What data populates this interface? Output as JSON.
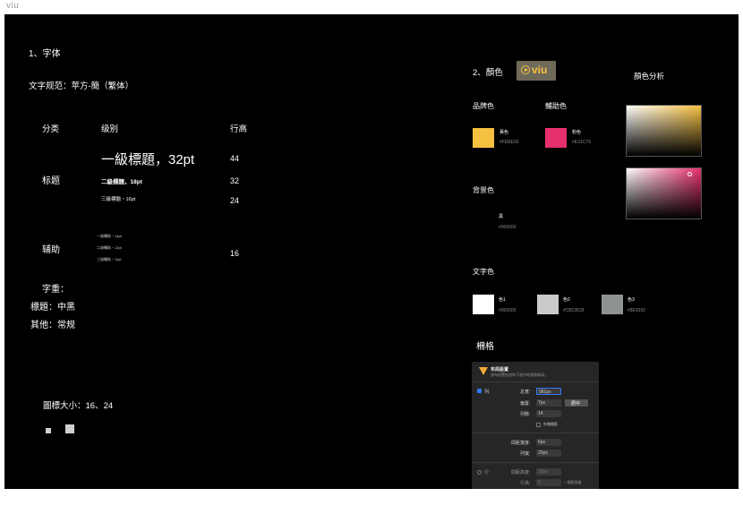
{
  "window": {
    "title": "viu"
  },
  "font_section": {
    "heading": "1、字体",
    "spec": "文字规范：苹方-簡（繁体）",
    "columns": {
      "category": "分类",
      "level": "级别",
      "line_height": "行高"
    },
    "title_category": "标题",
    "title_rows": [
      {
        "label": "一級標題，32pt",
        "line_height": "44"
      },
      {
        "label": "二級標題，18pt",
        "line_height": "32"
      },
      {
        "label": "三級標題・16pt",
        "line_height": "24"
      }
    ],
    "aux_category": "辅助",
    "aux_rows": [
      "一級輔助・14pt",
      "二級輔助・12pt",
      "三級輔助・11pt"
    ],
    "aux_line_height": "16",
    "weight": {
      "heading": "字重：",
      "title": "標題：中黑",
      "other": "其他：常规"
    },
    "icon_size": "圖標大小：16、24"
  },
  "color_section": {
    "heading": "2、顏色",
    "logo_text": "viu",
    "analysis": "顏色分析",
    "brand": {
      "label": "品牌色",
      "name": "黃色",
      "hex": "#FEBE00",
      "color": "#F6C041"
    },
    "aux": {
      "label": "輔助色",
      "name": "粉色",
      "hex": "#E31C79",
      "color": "#E6306E"
    },
    "background": {
      "label": "背景色",
      "name": "黑",
      "hex": "#000000"
    },
    "text_colors": {
      "label": "文字色",
      "items": [
        {
          "name": "色1",
          "hex": "#000000",
          "color": "#ffffff"
        },
        {
          "name": "色2",
          "hex": "#CBCBCB",
          "color": "#CBCBCB"
        },
        {
          "name": "色3",
          "hex": "#8E9392",
          "color": "#8E9392"
        }
      ]
    }
  },
  "grid_section": {
    "heading": "柵格",
    "panel": {
      "title": "布局設置",
      "subtitle": "該布設置在這布下面中的頁面佈局。",
      "columns_label": "列:",
      "total_width_label": "总宽:",
      "total_width_value": "981px",
      "offset_label": "偏置:",
      "offset_value": "7px",
      "center_button": "居中",
      "count_label": "列數:",
      "count_value": "14",
      "outer_gutter": "外側間距",
      "gutter_width_label": "間距寬度:",
      "gutter_width_value": "6px",
      "column_width_label": "列寬:",
      "column_width_value": "20px",
      "rows_label": "行:",
      "row_gutter_label": "間距高度:",
      "row_gutter_value": "10px",
      "row_height_label": "行高:",
      "row_height_value": "5",
      "row_height_suffix": "× 間距高度"
    }
  }
}
